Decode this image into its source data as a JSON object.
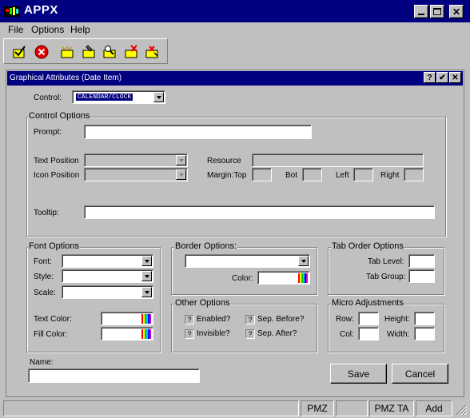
{
  "app": {
    "title": "APPX"
  },
  "menu": {
    "file": "File",
    "options": "Options",
    "help": "Help"
  },
  "dialog": {
    "title": "Graphical Attributes (Date Item)",
    "help_btn": "?",
    "ok_btn": "✔",
    "close_btn": "✕"
  },
  "control": {
    "label": "Control:",
    "value": "CALENDAR/CLOCK"
  },
  "control_options": {
    "title": "Control Options",
    "prompt_label": "Prompt:",
    "text_position_label": "Text Position",
    "icon_position_label": "Icon Position",
    "resource_label": "Resource",
    "margin_top_label": "Margin:Top",
    "bot_label": "Bot",
    "left_label": "Left",
    "right_label": "Right",
    "tooltip_label": "Tooltip:"
  },
  "font_options": {
    "title": "Font Options",
    "font_label": "Font:",
    "style_label": "Style:",
    "scale_label": "Scale:",
    "text_color_label": "Text Color:",
    "fill_color_label": "Fill Color:"
  },
  "border_options": {
    "title": "Border Options:",
    "color_label": "Color:"
  },
  "tab_order": {
    "title": "Tab Order Options",
    "level_label": "Tab Level:",
    "group_label": "Tab Group:"
  },
  "other_options": {
    "title": "Other Options",
    "enabled": "Enabled?",
    "invisible": "Invisible?",
    "sep_before": "Sep. Before?",
    "sep_after": "Sep. After?",
    "check_mark": "?"
  },
  "micro": {
    "title": "Micro Adjustments",
    "row": "Row:",
    "height": "Height:",
    "col": "Col:",
    "width": "Width:"
  },
  "name_label": "Name:",
  "buttons": {
    "save": "Save",
    "cancel": "Cancel"
  },
  "status": {
    "s1": "PMZ",
    "s2": "PMZ TA",
    "s3": "Add"
  }
}
